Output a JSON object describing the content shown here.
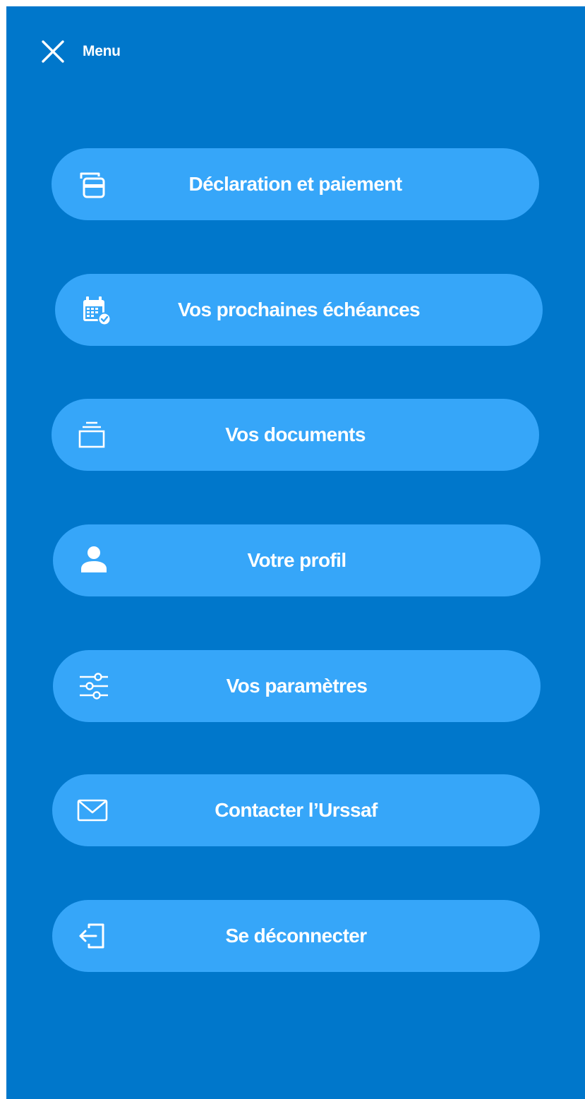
{
  "colors": {
    "panel_background": "#0077CB",
    "button_background": "#36A6F9",
    "text": "#FFFFFF"
  },
  "header": {
    "close_icon": "close-icon",
    "title": "Menu"
  },
  "menu": {
    "items": [
      {
        "label": "Déclaration et paiement",
        "icon": "credit-card-icon"
      },
      {
        "label": "Vos prochaines échéances",
        "icon": "calendar-check-icon"
      },
      {
        "label": "Vos documents",
        "icon": "documents-stack-icon"
      },
      {
        "label": "Votre profil",
        "icon": "user-icon"
      },
      {
        "label": "Vos paramètres",
        "icon": "sliders-icon"
      },
      {
        "label": "Contacter l’Urssaf",
        "icon": "envelope-icon"
      },
      {
        "label": "Se déconnecter",
        "icon": "logout-icon"
      }
    ]
  }
}
